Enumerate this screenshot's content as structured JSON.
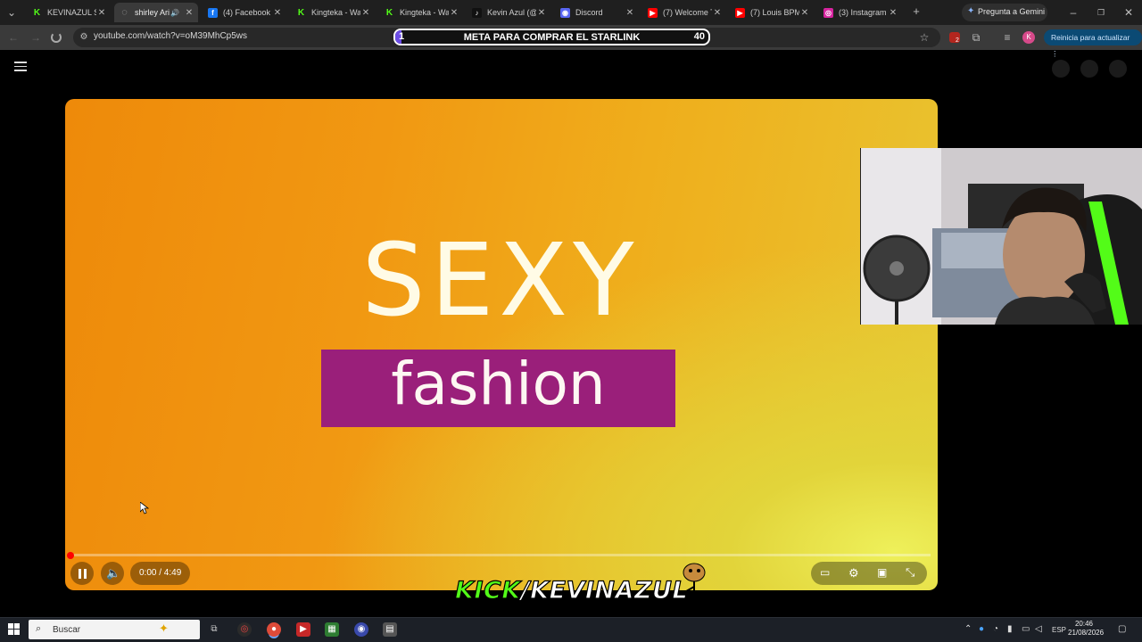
{
  "browser": {
    "tabs": [
      {
        "title": "KEVINAZUL St",
        "icon": "kick-logo",
        "color": "#53fc18",
        "active": false
      },
      {
        "title": "shirley Aria",
        "icon": "loading-spinner",
        "color": "#888888",
        "active": true,
        "muted_icon": "speaker-icon"
      },
      {
        "title": "(4) Facebook",
        "icon": "facebook-logo",
        "color": "#1877f2",
        "active": false
      },
      {
        "title": "Kingteka - Wa",
        "icon": "kick-logo",
        "color": "#53fc18",
        "active": false
      },
      {
        "title": "Kingteka - Wa",
        "icon": "kick-logo",
        "color": "#53fc18",
        "active": false
      },
      {
        "title": "Kevin Azul (@",
        "icon": "tiktok-logo",
        "color": "#111111",
        "active": false
      },
      {
        "title": "Discord",
        "icon": "discord-logo",
        "color": "#5865f2",
        "active": false
      },
      {
        "title": "(7) Welcome T",
        "icon": "youtube-logo",
        "color": "#ff0000",
        "active": false
      },
      {
        "title": "(7) Louis BPM",
        "icon": "youtube-logo",
        "color": "#ff0000",
        "active": false
      },
      {
        "title": "(3) Instagram",
        "icon": "instagram-logo",
        "color": "#d6249f",
        "active": false
      }
    ],
    "new_tab_symbol": "+",
    "gemini_label": "Pregunta a Gemini",
    "url": "youtube.com/watch?v=oM39MhCp5ws",
    "update_label": "Reinicia para actualizar",
    "profile_initial": "K",
    "extension_badge": "2"
  },
  "goal_overlay": {
    "start": "1",
    "text": "META PARA COMPRAR EL STARLINK",
    "end": "40",
    "progress_fraction": 0.02,
    "fill_color": "#6c4de6"
  },
  "video": {
    "title_line1": "SEXY",
    "title_line2": "fashion",
    "time": "0:00 / 4:49",
    "progress_fraction": 0.0,
    "progress_color": "#ff0000"
  },
  "stream_overlay": {
    "kick_part": "KICK",
    "rest_part": "/KEVINAZUL",
    "kick_color": "#53fc18"
  },
  "taskbar": {
    "search_placeholder": "Buscar",
    "language": "ESP",
    "time": "20:46",
    "date": "21/08/2026"
  }
}
